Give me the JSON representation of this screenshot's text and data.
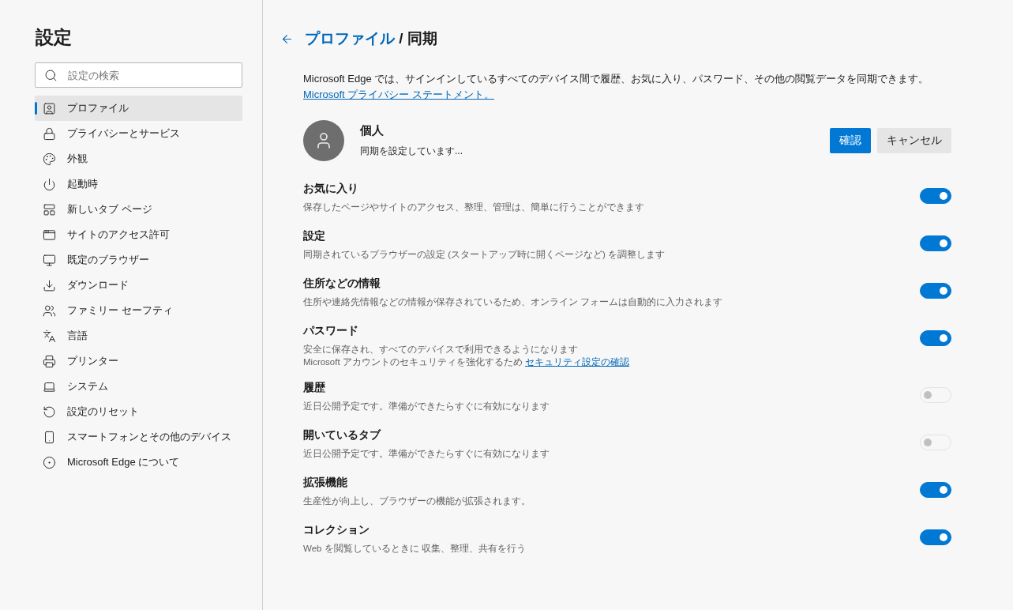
{
  "sidebar": {
    "title": "設定",
    "search": {
      "placeholder": "設定の検索"
    },
    "items": [
      {
        "label": "プロファイル",
        "selected": true
      },
      {
        "label": "プライバシーとサービス",
        "selected": false
      },
      {
        "label": "外観",
        "selected": false
      },
      {
        "label": "起動時",
        "selected": false
      },
      {
        "label": "新しいタブ ページ",
        "selected": false
      },
      {
        "label": "サイトのアクセス許可",
        "selected": false
      },
      {
        "label": "既定のブラウザー",
        "selected": false
      },
      {
        "label": "ダウンロード",
        "selected": false
      },
      {
        "label": "ファミリー セーフティ",
        "selected": false
      },
      {
        "label": "言語",
        "selected": false
      },
      {
        "label": "プリンター",
        "selected": false
      },
      {
        "label": "システム",
        "selected": false
      },
      {
        "label": "設定のリセット",
        "selected": false
      },
      {
        "label": "スマートフォンとその他のデバイス",
        "selected": false
      },
      {
        "label": "Microsoft Edge について",
        "selected": false
      }
    ]
  },
  "header": {
    "parent": "プロファイル",
    "separator": "/",
    "current": "同期"
  },
  "intro": {
    "text": "Microsoft Edge では、サインインしているすべてのデバイス間で履歴、お気に入り、パスワード、その他の閲覧データを同期できます。",
    "link": "Microsoft プライバシー ステートメント。"
  },
  "profile": {
    "name": "個人",
    "status": "同期を設定しています...",
    "buttons": [
      "確認",
      "キャンセル"
    ]
  },
  "sync_items": [
    {
      "title": "お気に入り",
      "description": "保存したページやサイトのアクセス、整理、管理は、簡単に行うことができます",
      "on": true,
      "disabled": false
    },
    {
      "title": "設定",
      "description": "同期されているブラウザーの設定 (スタートアップ時に開くページなど) を調整します",
      "on": true,
      "disabled": false
    },
    {
      "title": "住所などの情報",
      "description": "住所や連絡先情報などの情報が保存されているため、オンライン フォームは自動的に入力されます",
      "on": true,
      "disabled": false
    },
    {
      "title": "パスワード",
      "description": "安全に保存され、すべてのデバイスで利用できるようになります",
      "note": "Microsoft アカウントのセキュリティを強化するため",
      "note_link": "セキュリティ設定の確認",
      "on": true,
      "disabled": false
    },
    {
      "title": "履歴",
      "description": "近日公開予定です。準備ができたらすぐに有効になります",
      "on": false,
      "disabled": true
    },
    {
      "title": "開いているタブ",
      "description": "近日公開予定です。準備ができたらすぐに有効になります",
      "on": false,
      "disabled": true
    },
    {
      "title": "拡張機能",
      "description": "生産性が向上し、ブラウザーの機能が拡張されます。",
      "on": true,
      "disabled": false
    },
    {
      "title": "コレクション",
      "description": "Web を閲覧しているときに 収集、整理、共有を行う",
      "on": true,
      "disabled": false
    }
  ]
}
